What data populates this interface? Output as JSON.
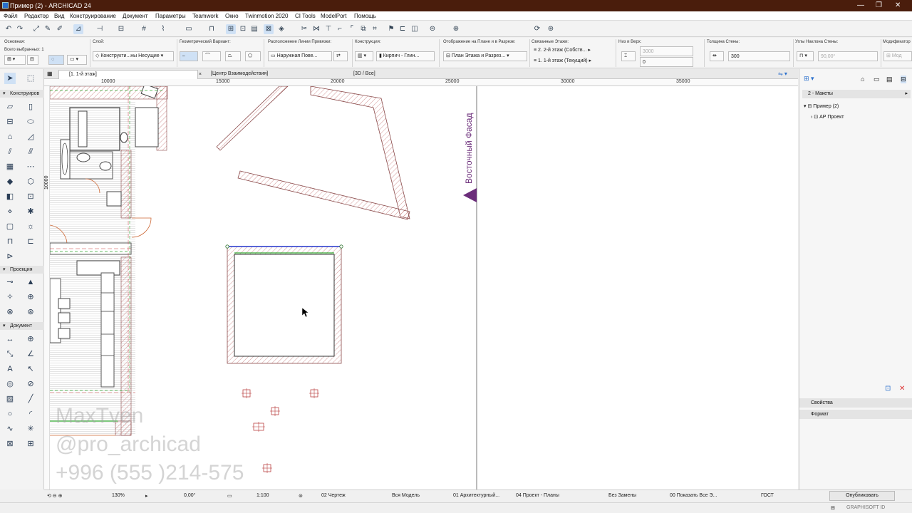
{
  "window": {
    "title": "Пример (2) - ARCHICAD 24",
    "minimize": "—",
    "maximize": "❐",
    "close": "✕"
  },
  "menu": [
    "Файл",
    "Редактор",
    "Вид",
    "Конструирование",
    "Документ",
    "Параметры",
    "Teamwork",
    "Окно",
    "Twinmotion 2020",
    "CI Tools",
    "ModelPort",
    "Помощь"
  ],
  "infobox": {
    "main_label": "Основная:",
    "selected_label": "Всего выбранных: 1",
    "layer_label": "Слой:",
    "layer_value": "Конструкти...ны Несущие",
    "geometry_label": "Геометрический Вариант:",
    "ref_line_label": "Расположение Линии Привязки:",
    "ref_line_value": "Наружная Пове...",
    "structure_label": "Конструкция:",
    "structure_value": "Кирпич - Глин...",
    "floorplan_label": "Отображение на Плане и в Разрезе:",
    "floorplan_value": "План Этажа и Разрез...",
    "linked_stories_label": "Связанные Этажи:",
    "linked_top": "2. 2-й этаж (Собств...",
    "linked_bottom": "1. 1-й этаж (Текущий)",
    "top_bottom_label": "Низ и Верх:",
    "top_value": "3000",
    "bottom_value": "0",
    "thickness_label": "Толщина Стены:",
    "thickness_value": "300",
    "slant_label": "Углы Наклона Стены:",
    "slant_value": "90,00°",
    "modifier_label": "Модификатор",
    "modifier_value": "Мод"
  },
  "toolbox": {
    "sections": [
      "Конструиров",
      "Проекция",
      "Документ"
    ]
  },
  "tabs": [
    {
      "label": "[1. 1-й этаж]",
      "active": true,
      "close": "×"
    },
    {
      "label": "[Центр Взаимодействия]",
      "active": false
    },
    {
      "label": "[3D / Все]",
      "active": false
    }
  ],
  "ruler": {
    "marks": [
      "10000",
      "15000",
      "20000",
      "25000",
      "30000",
      "35000"
    ],
    "vmark": "10000"
  },
  "canvas": {
    "elevation_label": "Восточный Фасад",
    "watermark_lines": [
      "MaxTven",
      "@pro_archicad",
      "+996 (555 )214-575"
    ],
    "colors": {
      "wall_hatch": "#c87a7a",
      "selected_edge": "#2233cc",
      "green_line": "#33aa33",
      "elevation_marker": "#6b2d7a"
    }
  },
  "navigator": {
    "dropdown": "2 - Макеты",
    "tree_root": "Пример (2)",
    "tree_child": "АР Проект",
    "panel_properties": "Свойства",
    "panel_format": "Формат"
  },
  "bottombar": {
    "zoom": "130%",
    "angle": "0,00°",
    "scale": "1:100",
    "layer_combo": "02 Чертеж",
    "model_view": "Вся Модель",
    "pen_set": "01 Архитектурный...",
    "dimension": "04 Проект - Планы",
    "override": "Без Замены",
    "renovation": "00 Показать Все Э...",
    "standard": "ГОСТ",
    "publish": "Опубликовать"
  },
  "status": {
    "brand": "GRAPHISOFT ID"
  }
}
